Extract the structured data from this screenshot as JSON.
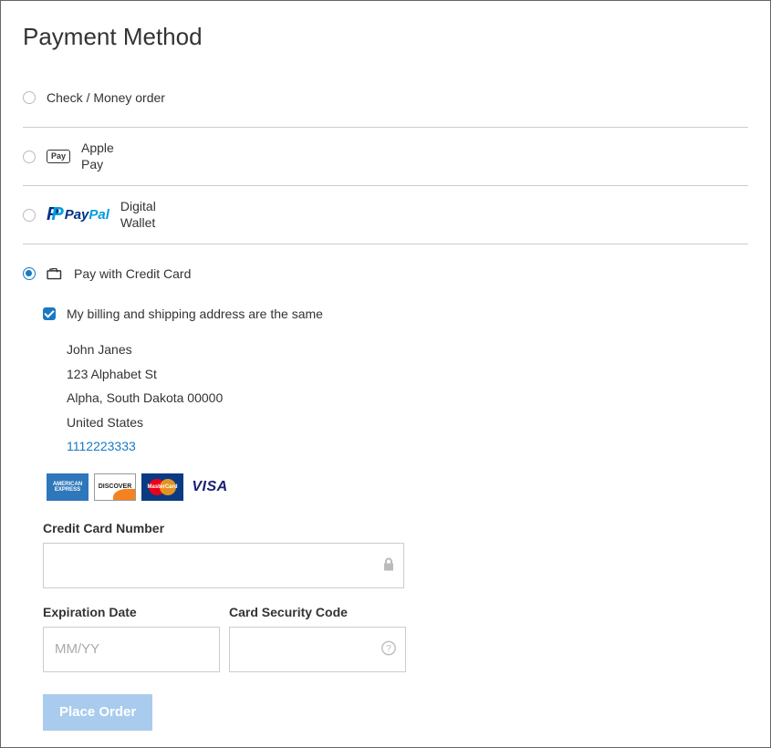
{
  "title": "Payment Method",
  "methods": {
    "check_label": "Check / Money order",
    "apple_top": "Apple",
    "apple_bottom": "Pay",
    "applepay_badge": "Pay",
    "digital_top": "Digital",
    "digital_bottom": "Wallet",
    "cc_label": "Pay with Credit Card"
  },
  "billing": {
    "same_label": "My billing and shipping address are the same",
    "name": "John Janes",
    "street": "123 Alphabet St",
    "city_line": "Alpha, South Dakota 00000",
    "country": "United States",
    "phone": "1112223333"
  },
  "card_brands": {
    "amex": "AMERICAN EXPRESS",
    "discover": "DISCOVER",
    "mastercard": "MasterCard",
    "visa": "VISA"
  },
  "form": {
    "cc_number_label": "Credit Card Number",
    "exp_label": "Expiration Date",
    "exp_placeholder": "MM/YY",
    "csc_label": "Card Security Code",
    "place_order": "Place Order"
  }
}
